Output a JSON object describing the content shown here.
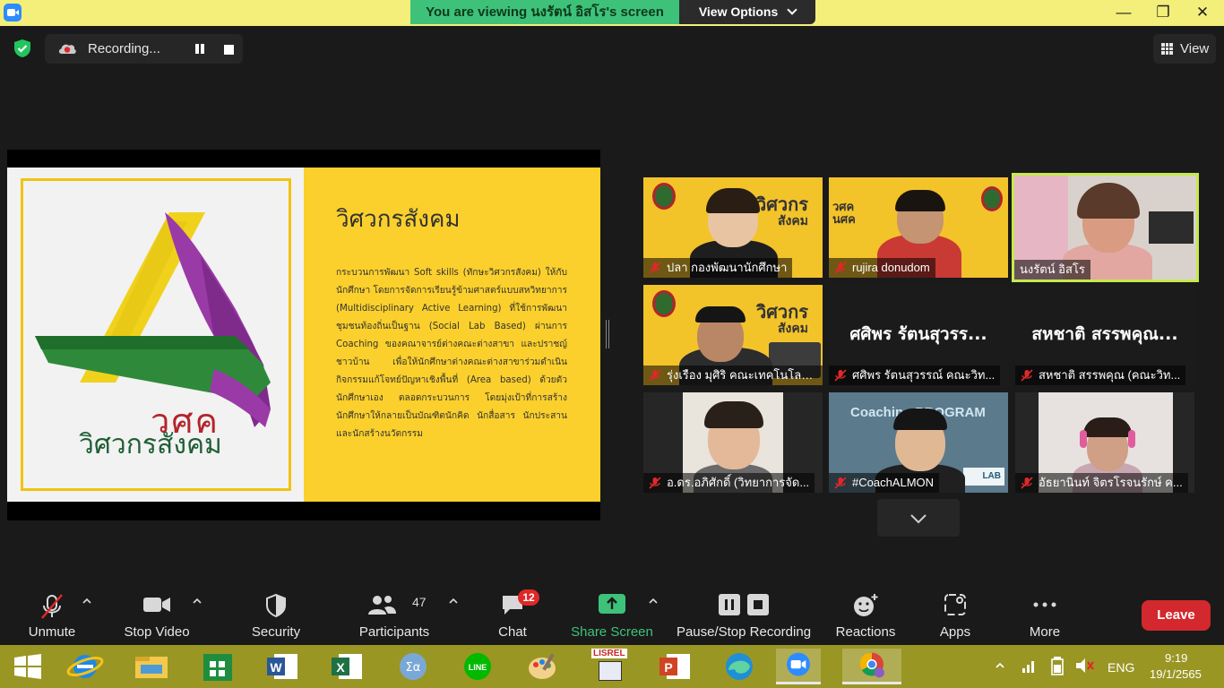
{
  "titlebar": {
    "banner": "You are viewing นงรัตน์ อิสโร's screen",
    "view_options": "View Options",
    "minimize": "—",
    "restore": "❐",
    "close": "✕"
  },
  "recording": {
    "label": "Recording..."
  },
  "view_button": "View",
  "slide": {
    "logo_abbr": "วศค",
    "logo_name": "วิศวกรสังคม",
    "title": "วิศวกรสังคม",
    "body": "กระบวนการพัฒนา Soft skills (ทักษะวิศวกรสังคม) ให้กับนักศึกษา โดยการจัดการเรียนรู้ข้ามศาสตร์แบบสหวิทยาการ (Multidisciplinary Active Learning) ที่ใช้การพัฒนาชุมชนท้องถิ่นเป็นฐาน (Social Lab Based) ผ่านการ Coaching ของคณาจารย์ต่างคณะต่างสาขา และปราชญ์ชาวบ้าน เพื่อให้นักศึกษาต่างคณะต่างสาขาร่วมดำเนินกิจกรรมแก้โจทย์ปัญหาเชิงพื้นที่ (Area based) ด้วยตัวนักศึกษาเอง ตลอดกระบวนการ โดยมุ่งเป้าที่การสร้างนักศึกษาให้กลายเป็นบัณฑิตนักคิด นักสื่อสาร นักประสาน และนักสร้างนวัตกรรม"
  },
  "participants_gallery": [
    {
      "name": "ปลา กองพัฒนานักศึกษา",
      "big": ""
    },
    {
      "name": "rujira donudom",
      "big": ""
    },
    {
      "name": "นงรัตน์ อิสโร",
      "big": ""
    },
    {
      "name": "รุ่งเรือง มุศิริ คณะเทคโนโลยี...",
      "big": ""
    },
    {
      "name": "ศศิพร รัตนสุวรรณ์ คณะวิท...",
      "big": "ศศิพร รัตนสุวรร..."
    },
    {
      "name": "สหชาติ สรรพคุณ (คณะวิท...",
      "big": "สหชาติ สรรพคุณ..."
    },
    {
      "name": "อ.ดร.อภิศักดิ์ (วิทยาการจัด...",
      "big": ""
    },
    {
      "name": "#CoachALMON",
      "big": ""
    },
    {
      "name": "อัธยานินท์ จิตรโรจนรักษ์ ค...",
      "big": ""
    }
  ],
  "tile_slide_text": {
    "main": "วิศวกร",
    "sub": "สังคม",
    "tile2_a": "วศค",
    "tile2_b": "นศค",
    "coaching": "Coaching PROGRAM",
    "coaching_for": "for",
    "lab": "LAB"
  },
  "toolbar": {
    "unmute": "Unmute",
    "stop_video": "Stop Video",
    "security": "Security",
    "participants": "Participants",
    "participants_count": "47",
    "chat": "Chat",
    "chat_badge": "12",
    "share_screen": "Share Screen",
    "pause_stop_recording": "Pause/Stop Recording",
    "reactions": "Reactions",
    "apps": "Apps",
    "more": "More",
    "leave": "Leave"
  },
  "taskbar": {
    "lang": "ENG",
    "time": "9:19",
    "date": "19/1/2565",
    "lisrel": "LISREL"
  },
  "colors": {
    "zoom_green": "#3ec27a",
    "active_speaker": "#c6e94f",
    "leave_red": "#d3282d",
    "slide_yellow": "#fbd02c",
    "taskbar": "#9a9624"
  }
}
